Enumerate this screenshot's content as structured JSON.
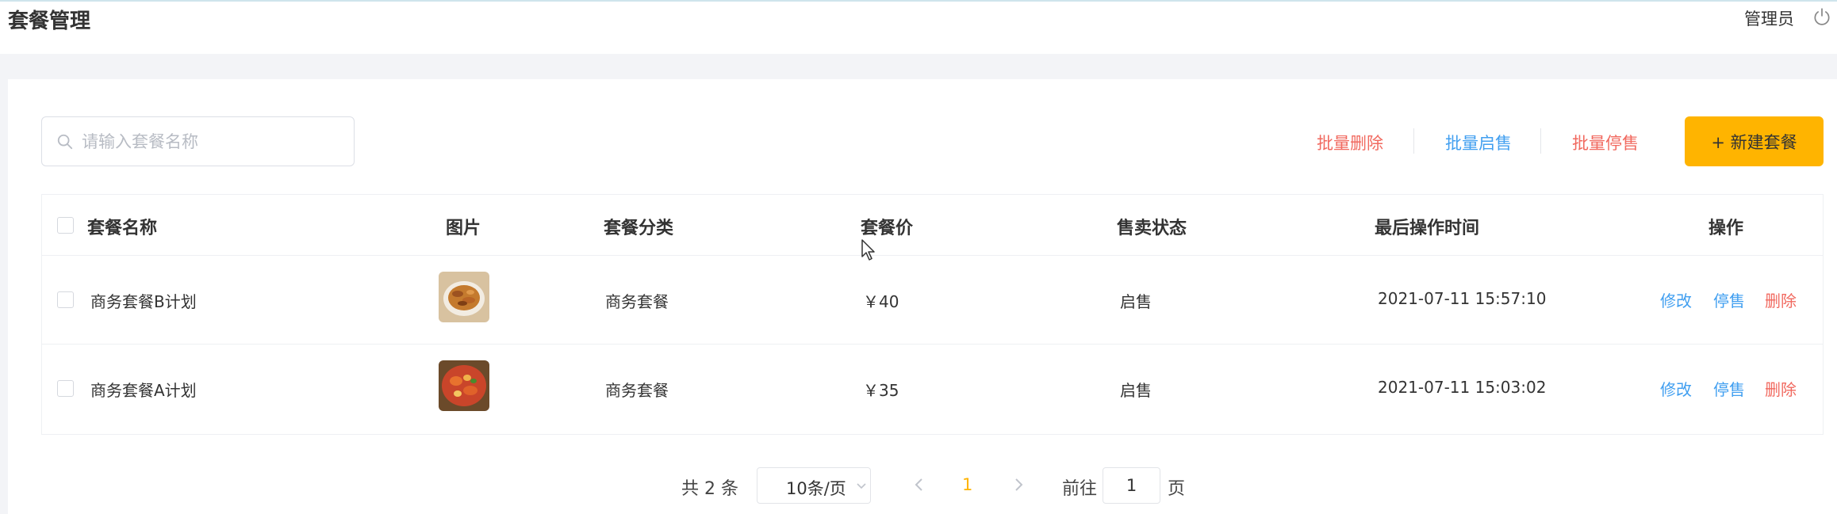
{
  "header": {
    "title": "套餐管理",
    "user": "管理员"
  },
  "toolbar": {
    "search_placeholder": "请输入套餐名称",
    "batch_delete": "批量删除",
    "batch_on_sale": "批量启售",
    "batch_off_sale": "批量停售",
    "new_button": "+ 新建套餐"
  },
  "table": {
    "columns": [
      "套餐名称",
      "图片",
      "套餐分类",
      "套餐价",
      "售卖状态",
      "最后操作时间",
      "操作"
    ],
    "rows": [
      {
        "name": "商务套餐B计划",
        "category": "商务套餐",
        "price": "￥40",
        "status": "启售",
        "updated": "2021-07-11 15:57:10",
        "actions": [
          "修改",
          "停售",
          "删除"
        ]
      },
      {
        "name": "商务套餐A计划",
        "category": "商务套餐",
        "price": "￥35",
        "status": "启售",
        "updated": "2021-07-11 15:03:02",
        "actions": [
          "修改",
          "停售",
          "删除"
        ]
      }
    ]
  },
  "pagination": {
    "total": "共 2 条",
    "page_size": "10条/页",
    "current_page": "1",
    "goto_prefix": "前往",
    "goto_value": "1",
    "goto_suffix": "页"
  },
  "colors": {
    "accent": "#ffb400",
    "link_blue": "#419ff0",
    "danger_red": "#f1695f"
  }
}
